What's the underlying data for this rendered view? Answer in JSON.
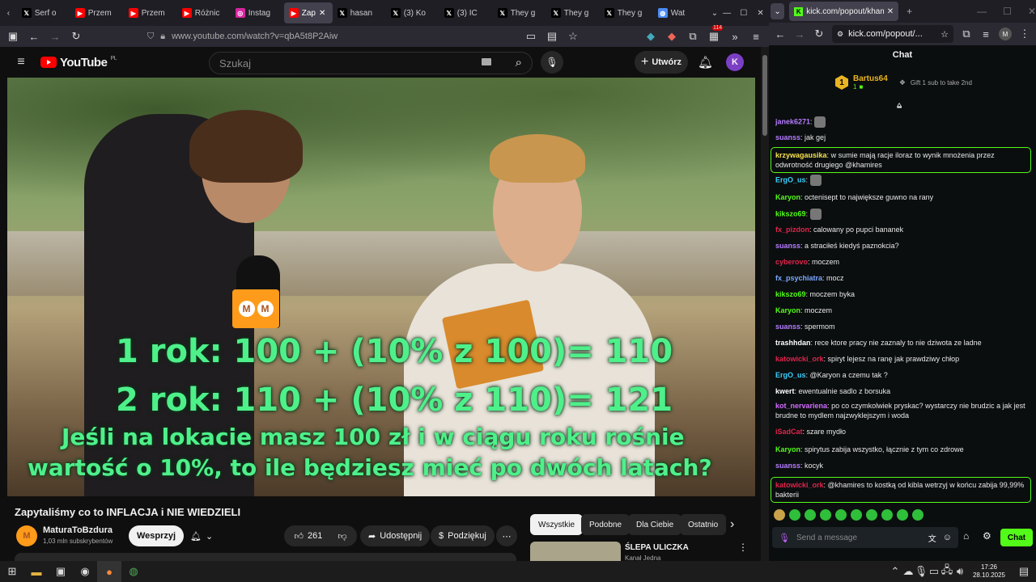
{
  "browser_left": {
    "tabs": [
      {
        "label": "Serf o",
        "icon": "x-icon"
      },
      {
        "label": "Przem",
        "icon": "youtube-icon"
      },
      {
        "label": "Przem",
        "icon": "youtube-icon"
      },
      {
        "label": "Różnic",
        "icon": "youtube-icon"
      },
      {
        "label": "Instag",
        "icon": "instagram-icon"
      },
      {
        "label": "Zap",
        "icon": "youtube-icon"
      },
      {
        "label": "hasan",
        "icon": "x-icon"
      },
      {
        "label": "(3) Ko",
        "icon": "x-icon"
      },
      {
        "label": "(3) IC",
        "icon": "x-icon"
      },
      {
        "label": "They g",
        "icon": "x-icon"
      },
      {
        "label": "They g",
        "icon": "x-icon"
      },
      {
        "label": "They g",
        "icon": "x-icon"
      },
      {
        "label": "Wat",
        "icon": "globe-icon"
      }
    ],
    "url": "www.youtube.com/watch?v=qbA5t8P2Aiw",
    "extension_badge": "114"
  },
  "youtube": {
    "logo_text": "YouTube",
    "logo_region": "PL",
    "search_placeholder": "Szukaj",
    "create_label": "Utwórz",
    "avatar_letter": "K",
    "video_lines": [
      "1 rok: 100 + (10% z 100)= 110",
      "2 rok: 110 + (10% z 110)= 121",
      "Jeśli na lokacie masz 100 zł i w ciągu roku rośnie",
      "wartość o 10%, to ile będziesz mieć po dwóch latach?"
    ],
    "mic_logo": "M",
    "title": "Zapytaliśmy co to INFLACJA i NIE WIEDZIELI",
    "channel": "MaturaToBzdura",
    "subscribers": "1,03 mln subskrybentów",
    "support_label": "Wesprzyj",
    "likes": "261",
    "share_label": "Udostępnij",
    "thanks_label": "Podziękuj",
    "filter_tabs": [
      "Wszystkie",
      "Podobne",
      "Dla Ciebie",
      "Ostatnio"
    ],
    "rec_title": "ŚLEPA ULICZKA",
    "rec_channel": "Kanał Jedna"
  },
  "browser_right": {
    "tab_title": "kick.com/popout/khamires/cha",
    "url": "kick.com/popout/...",
    "profile_letter": "M"
  },
  "chat": {
    "header": "Chat",
    "top_gifter": {
      "rank": "1",
      "name": "Bartus64",
      "count": "1",
      "gift_text": "Gift 1 sub to take 2nd"
    },
    "messages": [
      {
        "user": "janek6271",
        "text": "",
        "color": "#b57cff"
      },
      {
        "user": "suanss",
        "text": "jak gej",
        "color": "#b57cff"
      },
      {
        "user": "krzywagausika",
        "text": "w sumie mają racje iloraz to wynik mnożenia przez odwrotność drugiego  @khamires",
        "color": "#f7e24b"
      },
      {
        "user": "ErgO_us",
        "text": "",
        "color": "#3ad0ff"
      },
      {
        "user": "Karyon",
        "text": "octenisept to największe guwno na rany",
        "color": "#53fc18"
      },
      {
        "user": "kikszo69",
        "text": "",
        "color": "#53fc18"
      },
      {
        "user": "fx_pizdon",
        "text": "calowany po pupci bananek",
        "color": "#e0244b"
      },
      {
        "user": "suanss",
        "text": "a straciłeś kiedyś paznokcia?",
        "color": "#b57cff"
      },
      {
        "user": "cyberovo",
        "text": "moczem",
        "color": "#e0244b"
      },
      {
        "user": "fx_psychiatra",
        "text": "mocz",
        "color": "#79a8ff"
      },
      {
        "user": "kikszo69",
        "text": "moczem byka",
        "color": "#53fc18"
      },
      {
        "user": "Karyon",
        "text": "moczem",
        "color": "#53fc18"
      },
      {
        "user": "suanss",
        "text": "spermom",
        "color": "#b57cff"
      },
      {
        "user": "trashhdan",
        "text": "rece ktore pracy nie zaznaly to nie dziwota ze ladne",
        "color": "#ffffff"
      },
      {
        "user": "katowicki_ork",
        "text": "spiryt lejesz na ranę jak prawdziwy chłop",
        "color": "#e0244b"
      },
      {
        "user": "ErgO_us",
        "text": "@Karyon a czemu tak ?",
        "color": "#3ad0ff"
      },
      {
        "user": "kwert",
        "text": "ewentualnie sadlo z borsuka",
        "color": "#ffffff"
      },
      {
        "user": "kot_nervariena",
        "text": "po co czymkolwiek pryskac? wystarczy nie brudzic a jak jest brudne to mydlem najzwyklejszym i woda",
        "color": "#d36bff"
      },
      {
        "user": "iSadCat",
        "text": "szare mydło",
        "color": "#e0244b"
      },
      {
        "user": "Karyon",
        "text": "spirytus zabija wszystko, łącznie z tym co zdrowe",
        "color": "#53fc18"
      },
      {
        "user": "suanss",
        "text": "kocyk",
        "color": "#b57cff"
      },
      {
        "user": "katowicki_ork",
        "text": "@khamires to kostką od kibla wetrzyj w końcu zabija 99,99% bakterii",
        "color": "#e0244b"
      }
    ],
    "input_placeholder": "Send a message",
    "send_label": "Chat"
  },
  "taskbar": {
    "time": "17:26",
    "date": "28.10.2025"
  }
}
